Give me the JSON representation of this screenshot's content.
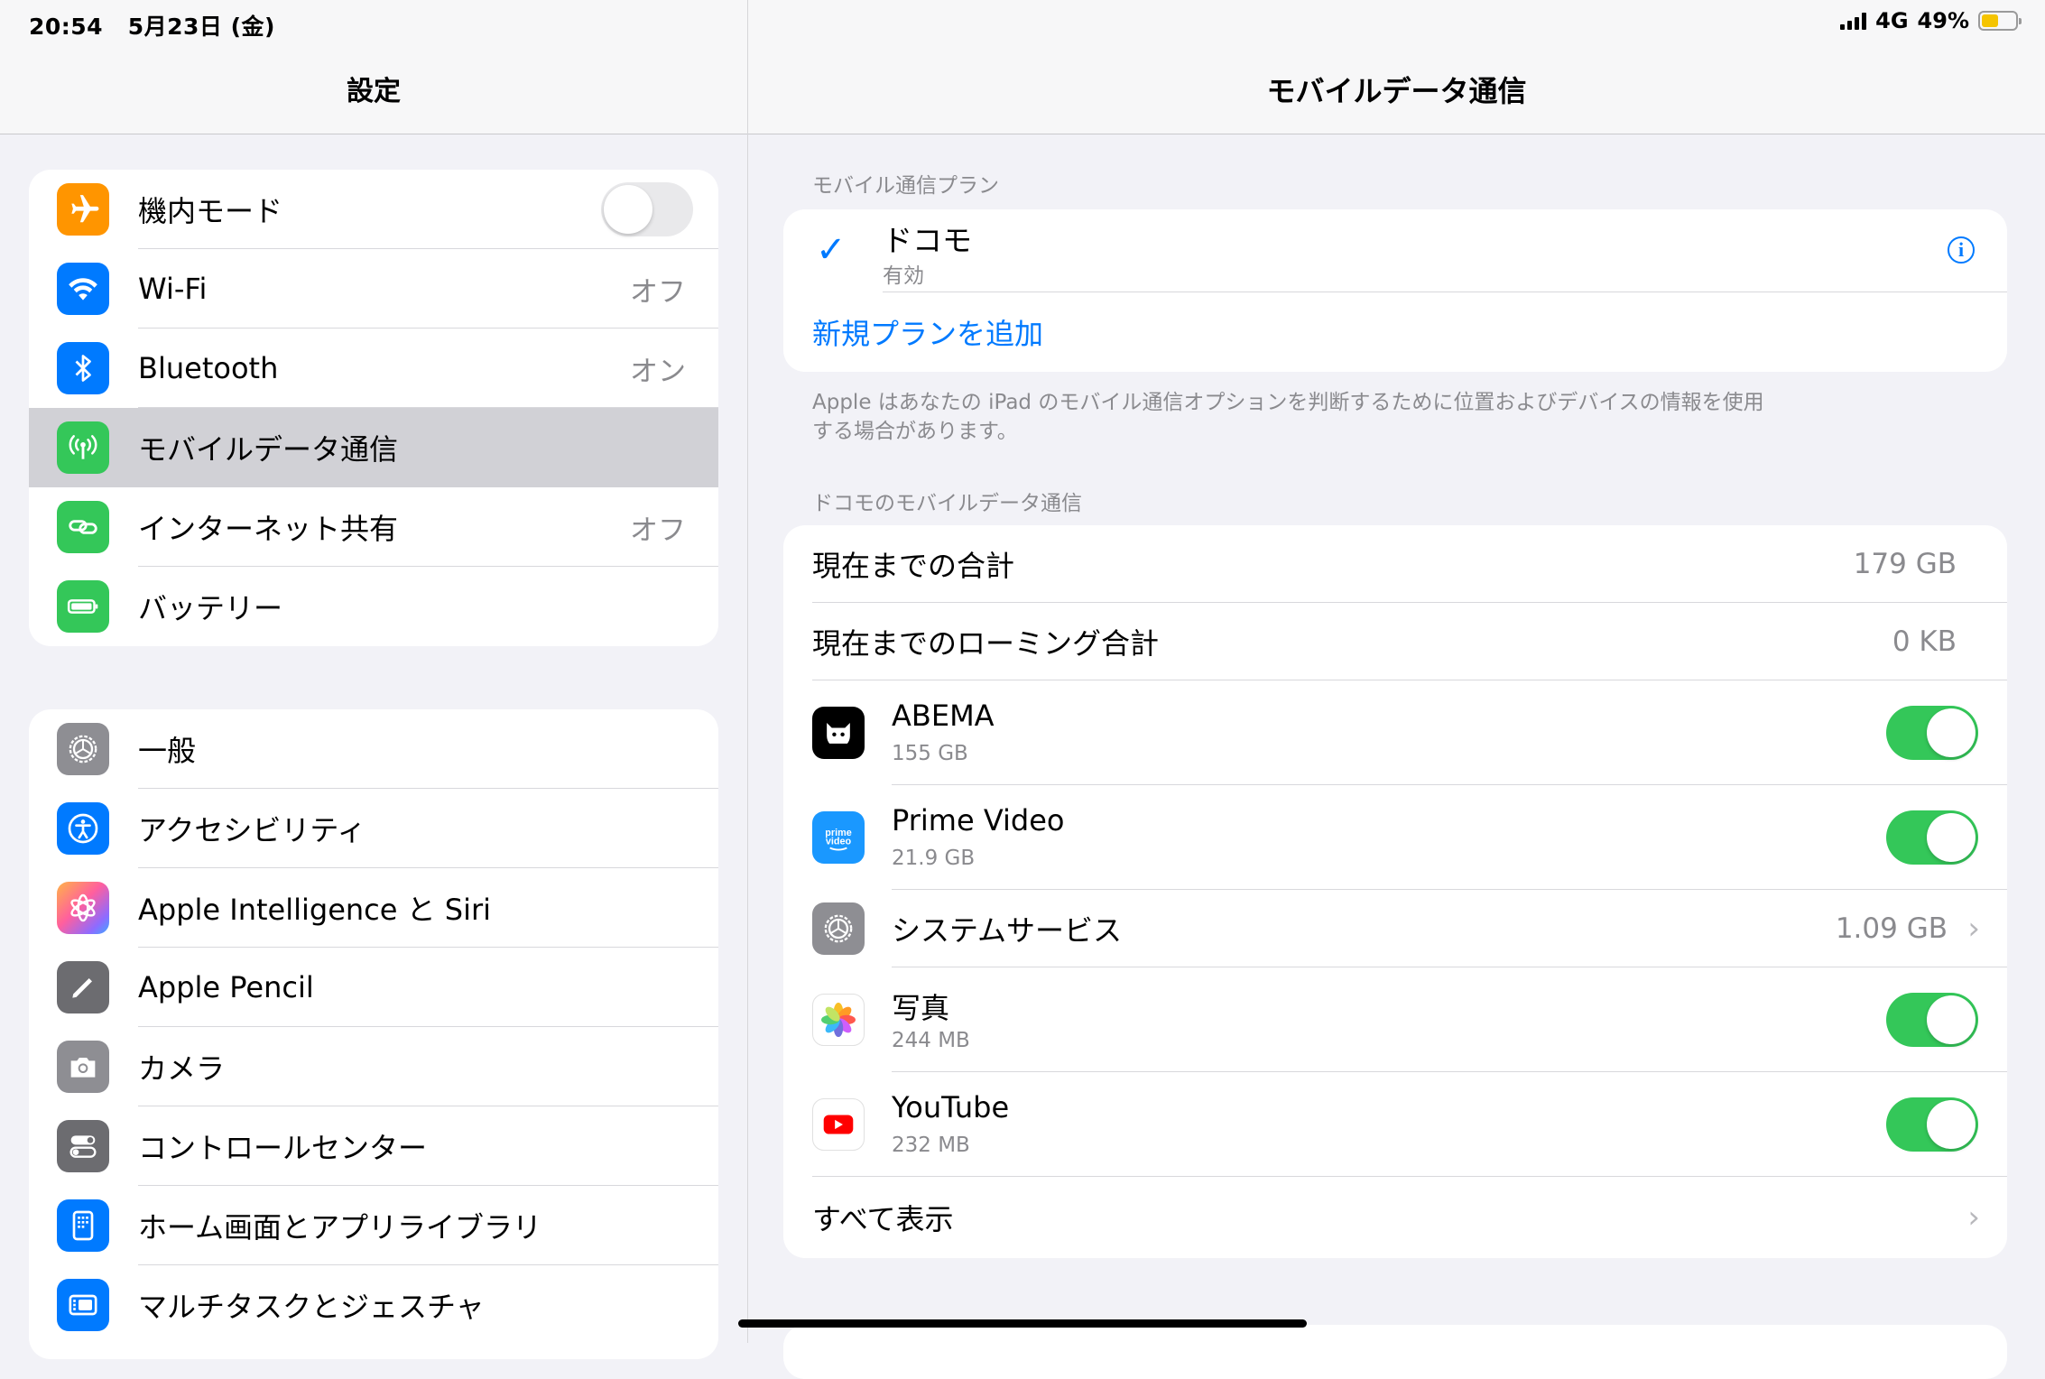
{
  "status": {
    "time": "20:54",
    "date": "5月23日 (金)",
    "network": "4G",
    "battery": "49%",
    "battery_level": 0.49
  },
  "sidebar": {
    "title": "設定",
    "group1": [
      {
        "label": "機内モード",
        "value": "",
        "icon": "airplane-icon",
        "color": "#ff9500"
      },
      {
        "label": "Wi-Fi",
        "value": "オフ",
        "icon": "wifi-icon",
        "color": "#007aff"
      },
      {
        "label": "Bluetooth",
        "value": "オン",
        "icon": "bluetooth-icon",
        "color": "#007aff"
      },
      {
        "label": "モバイルデータ通信",
        "value": "",
        "icon": "antenna-icon",
        "color": "#34c759"
      },
      {
        "label": "インターネット共有",
        "value": "オフ",
        "icon": "link-icon",
        "color": "#34c759"
      },
      {
        "label": "バッテリー",
        "value": "",
        "icon": "battery-icon",
        "color": "#34c759"
      }
    ],
    "group2": [
      {
        "label": "一般",
        "icon": "gear-icon",
        "color": "#8e8e93"
      },
      {
        "label": "アクセシビリティ",
        "icon": "accessibility-icon",
        "color": "#007aff"
      },
      {
        "label": "Apple Intelligence と Siri",
        "icon": "siri-icon",
        "color": "#c46be0"
      },
      {
        "label": "Apple Pencil",
        "icon": "pencil-icon",
        "color": "#6c6c70"
      },
      {
        "label": "カメラ",
        "icon": "camera-icon",
        "color": "#8e8e93"
      },
      {
        "label": "コントロールセンター",
        "icon": "switches-icon",
        "color": "#6c6c70"
      },
      {
        "label": "ホーム画面とアプリライブラリ",
        "icon": "home-screen-icon",
        "color": "#007aff"
      },
      {
        "label": "マルチタスクとジェスチャ",
        "icon": "multitask-icon",
        "color": "#007aff"
      }
    ]
  },
  "detail": {
    "title": "モバイルデータ通信",
    "plan_section": "モバイル通信プラン",
    "plan": {
      "name": "ドコモ",
      "status": "有効"
    },
    "add_plan": "新規プランを追加",
    "footnote_line1": "Apple はあなたの iPad のモバイル通信オプションを判断するために位置およびデバイスの情報を使用",
    "footnote_line2": "する場合があります。",
    "usage_section": "ドコモのモバイルデータ通信",
    "total_label": "現在までの合計",
    "total_value": "179 GB",
    "roaming_label": "現在までのローミング合計",
    "roaming_value": "0 KB",
    "apps": [
      {
        "name": "ABEMA",
        "usage": "155 GB",
        "enabled": true,
        "icon": "abema-icon"
      },
      {
        "name": "Prime Video",
        "usage": "21.9 GB",
        "enabled": true,
        "icon": "prime-video-icon"
      },
      {
        "name": "システムサービス",
        "usage": "1.09 GB",
        "icon": "gear-icon"
      },
      {
        "name": "写真",
        "usage": "244 MB",
        "enabled": true,
        "icon": "photos-icon"
      },
      {
        "name": "YouTube",
        "usage": "232 MB",
        "enabled": true,
        "icon": "youtube-icon"
      }
    ],
    "show_all": "すべて表示"
  }
}
